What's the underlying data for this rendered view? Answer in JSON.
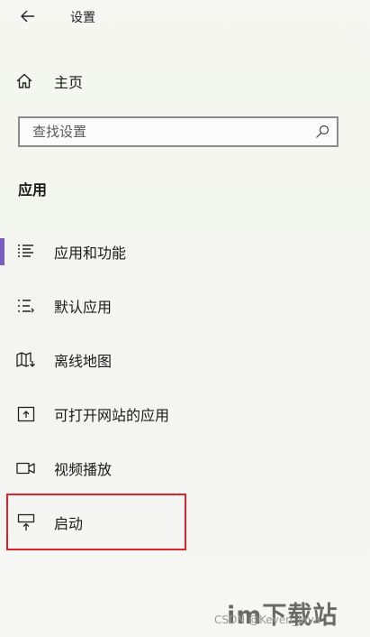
{
  "window": {
    "title": "设置"
  },
  "home": {
    "label": "主页"
  },
  "search": {
    "placeholder": "查找设置"
  },
  "section": {
    "title": "应用"
  },
  "nav": {
    "items": [
      {
        "label": "应用和功能",
        "icon": "apps-features-icon",
        "selected": true
      },
      {
        "label": "默认应用",
        "icon": "default-apps-icon"
      },
      {
        "label": "离线地图",
        "icon": "offline-maps-icon"
      },
      {
        "label": "可打开网站的应用",
        "icon": "apps-for-websites-icon"
      },
      {
        "label": "视频播放",
        "icon": "video-playback-icon"
      },
      {
        "label": "启动",
        "icon": "startup-icon"
      }
    ]
  },
  "colors": {
    "accent": "#7a5cc0",
    "highlight_border": "#d9252c"
  },
  "watermarks": {
    "csdn": "CSDN @Keven_Java",
    "logo": "im下载站"
  }
}
